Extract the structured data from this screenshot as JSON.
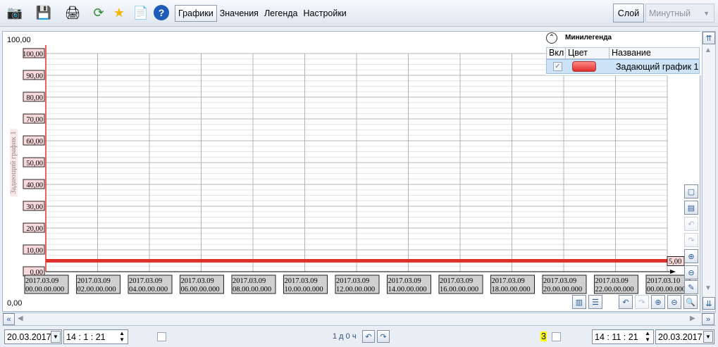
{
  "toolbar": {
    "tabs": [
      "Графики",
      "Значения",
      "Легенда",
      "Настройки"
    ],
    "active_tab": "Графики",
    "layer_label": "Слой",
    "interval_value": "Минутный"
  },
  "legend": {
    "title": "Минилегенда",
    "col_on": "Вкл",
    "col_color": "Цвет",
    "col_name": "Название",
    "row_name": "Задающий график 1",
    "row_color": "#e0302a"
  },
  "chart_top_value": "100,00",
  "chart_bottom_value": "0,00",
  "chart_data": {
    "type": "line",
    "ylabel": "Задающий график 1",
    "ylim": [
      0,
      100
    ],
    "yticks": [
      "100,00",
      "90,00",
      "80,00",
      "70,00",
      "60,00",
      "50,00",
      "40,00",
      "30,00",
      "20,00",
      "10,00",
      "0,00"
    ],
    "xticks": [
      [
        "2017.03.09",
        "00.00.00.000"
      ],
      [
        "2017.03.09",
        "02.00.00.000"
      ],
      [
        "2017.03.09",
        "04.00.00.000"
      ],
      [
        "2017.03.09",
        "06.00.00.000"
      ],
      [
        "2017.03.09",
        "08.00.00.000"
      ],
      [
        "2017.03.09",
        "10.00.00.000"
      ],
      [
        "2017.03.09",
        "12.00.00.000"
      ],
      [
        "2017.03.09",
        "14.00.00.000"
      ],
      [
        "2017.03.09",
        "16.00.00.000"
      ],
      [
        "2017.03.09",
        "18.00.00.000"
      ],
      [
        "2017.03.09",
        "20.00.00.000"
      ],
      [
        "2017.03.09",
        "22.00.00.000"
      ],
      [
        "2017.03.10",
        "00.00.00.000"
      ]
    ],
    "series": [
      {
        "name": "Задающий график 1",
        "color": "#e0302a",
        "x": [
          "2017.03.09 00:00",
          "2017.03.10 00:00"
        ],
        "values": [
          5,
          5
        ]
      }
    ],
    "end_label": "5,00",
    "grid": true
  },
  "status": {
    "start_date": "20.03.2017",
    "start_time": "14 : 1 : 21",
    "range_label": "1 д 0 ч",
    "count": "3",
    "end_time": "14 : 11 : 21",
    "end_date": "20.03.2017"
  }
}
